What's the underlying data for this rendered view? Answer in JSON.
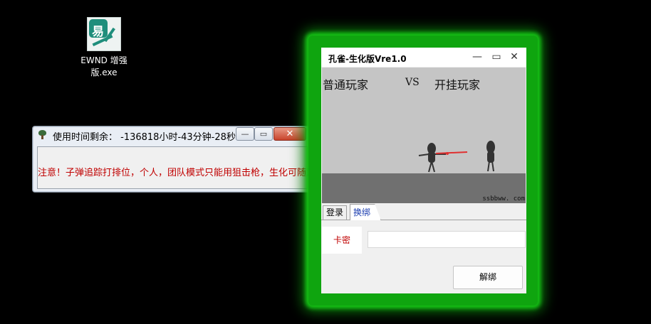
{
  "desktop": {
    "icon": {
      "label": "EWND 增强版.exe",
      "glyph": "易",
      "icon_name": "ewnd-app-icon"
    }
  },
  "warning_window": {
    "title": "使用时间剩余： -136818小时-43分钟-28秒",
    "message": "注意！子弹追踪打排位，个人，团队模式只能用狙击枪，生化可随意",
    "controls": {
      "minimize": "—",
      "maximize": "▭",
      "close": "✕"
    },
    "colors": {
      "message": "#c00000",
      "close": "#c8432b"
    }
  },
  "main_window": {
    "title": "孔雀-生化版Vre1.0",
    "controls": {
      "minimize": "—",
      "maximize": "▭",
      "close": "✕"
    },
    "banner": {
      "left": "普通玩家",
      "vs": "VS",
      "right": "开挂玩家",
      "watermark": "ssbbww. com"
    },
    "tabs": [
      {
        "label": "登录",
        "active": false
      },
      {
        "label": "换绑",
        "active": true
      }
    ],
    "form": {
      "key_label": "卡密",
      "key_value": "",
      "key_placeholder": "",
      "unbind_button": "解绑"
    },
    "colors": {
      "glow": "#16c516",
      "label": "#c00000",
      "active_tab": "#1d3fb0"
    }
  }
}
